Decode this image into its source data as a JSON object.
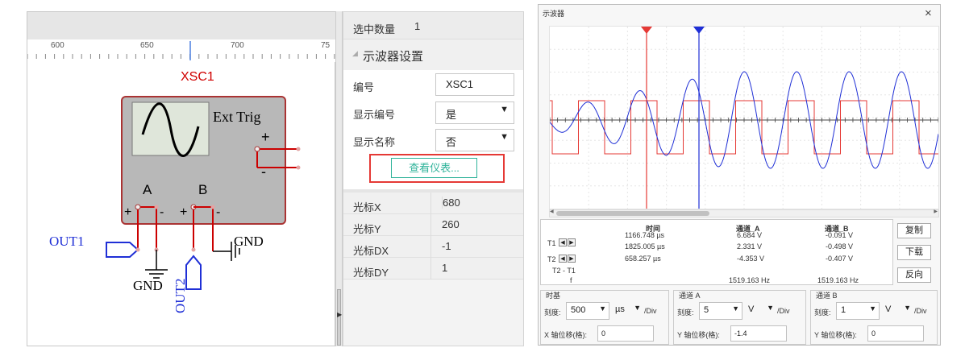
{
  "ruler": {
    "ticks": [
      "600",
      "650",
      "700",
      "75"
    ]
  },
  "component": {
    "ref": "XSC1",
    "ext_trig": "Ext Trig",
    "plus": "+",
    "minus": "-",
    "ch_a": "A",
    "ch_b": "B",
    "a_plus": "+",
    "a_minus": "-",
    "b_plus": "+",
    "b_minus": "-"
  },
  "net_labels": {
    "out1": "OUT1",
    "out2": "OUT2",
    "gnd1": "GND",
    "gnd2": "GND"
  },
  "props": {
    "selected_label": "选中数量",
    "selected_count": "1",
    "section_title": "示波器设置",
    "rows": [
      {
        "label": "编号",
        "value": "XSC1"
      },
      {
        "label": "显示编号",
        "value": "是"
      },
      {
        "label": "显示名称",
        "value": "否"
      }
    ],
    "view_button": "查看仪表...",
    "cursor_rows": [
      {
        "label": "光标X",
        "value": "680"
      },
      {
        "label": "光标Y",
        "value": "260"
      },
      {
        "label": "光标DX",
        "value": "-1"
      },
      {
        "label": "光标DY",
        "value": "1"
      }
    ]
  },
  "osc": {
    "title": "示波器",
    "close": "×",
    "meas": {
      "headers": [
        "时间",
        "通道_A",
        "通道_B"
      ],
      "t1_label": "T1",
      "t2_label": "T2",
      "dt_label": "T2 - T1",
      "f_label": "f",
      "t1": [
        "1166.748 µs",
        "6.684 V",
        "-0.091 V"
      ],
      "t2": [
        "1825.005 µs",
        "2.331 V",
        "-0.498 V"
      ],
      "dt": [
        "658.257 µs",
        "-4.353 V",
        "-0.407 V"
      ],
      "f": [
        "",
        "1519.163 Hz",
        "1519.163 Hz"
      ]
    },
    "buttons": {
      "copy": "复制",
      "download": "下载",
      "reverse": "反向"
    },
    "timebase": {
      "title": "时基",
      "scale_label": "刻度:",
      "scale": "500",
      "unit": "µs",
      "per_div": "/Div",
      "offset_label": "X 轴位移(格):",
      "offset": "0"
    },
    "ch_a": {
      "title": "通道 A",
      "scale_label": "刻度:",
      "scale": "5",
      "unit": "V",
      "per_div": "/Div",
      "offset_label": "Y 轴位移(格):",
      "offset": "-1.4"
    },
    "ch_b": {
      "title": "通道 B",
      "scale_label": "刻度:",
      "scale": "1",
      "unit": "V",
      "per_div": "/Div",
      "offset_label": "Y 轴位移(格):",
      "offset": "0"
    },
    "colors": {
      "ch_a": "#e53935",
      "ch_b": "#1f2fd6",
      "highlight": "#e53935",
      "accent": "#2fb39a"
    }
  }
}
